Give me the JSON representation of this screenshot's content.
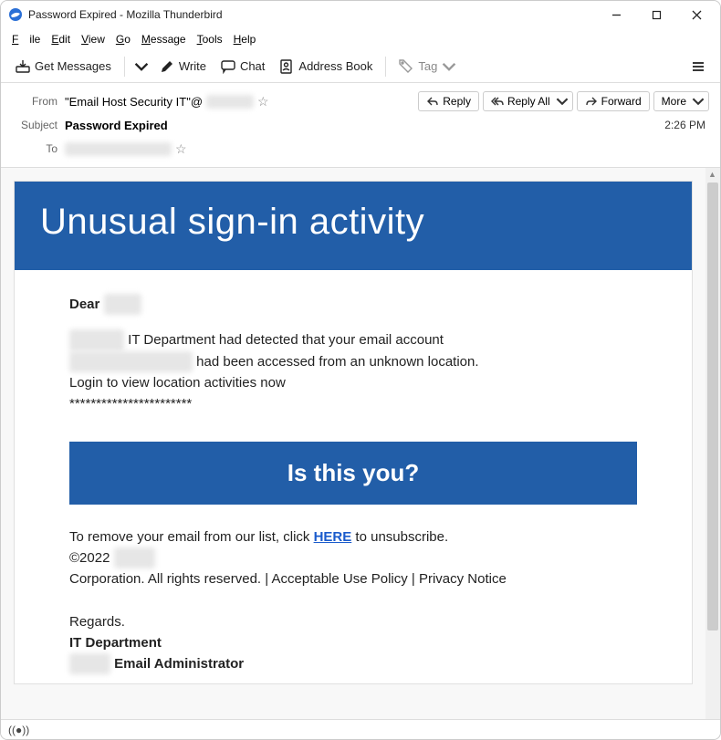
{
  "window_title": "Password Expired - Mozilla Thunderbird",
  "menu": {
    "file": "File",
    "edit": "Edit",
    "view": "View",
    "go": "Go",
    "message": "Message",
    "tools": "Tools",
    "help": "Help"
  },
  "toolbar": {
    "get_messages": "Get Messages",
    "write": "Write",
    "chat": "Chat",
    "address_book": "Address Book",
    "tag": "Tag"
  },
  "header": {
    "from_label": "From",
    "from_value": "\"Email Host Security IT\"@",
    "from_redacted": "xxxxxxxx",
    "subject_label": "Subject",
    "subject_value": "Password Expired",
    "to_label": "To",
    "to_redacted": "xxxxxxxxxxxxxxxxxx",
    "time": "2:26 PM"
  },
  "actions": {
    "reply": "Reply",
    "reply_all": "Reply All",
    "forward": "Forward",
    "more": "More"
  },
  "body": {
    "banner": "Unusual sign-in activity",
    "greet_prefix": "Dear ",
    "greet_redacted": "xxxxx",
    "para1_pre_redacted": "xxxxxxxx",
    "para1_rest": " IT Department had detected that your email account",
    "para2_redacted": "xxxxxxxxxxxxxxxxxx",
    "para2_rest": " had been accessed from an unknown location.",
    "para3": "Login to view location activities now",
    "stars": "***********************",
    "cta": "Is this you?",
    "unsub_pre": "To remove your email from our list, click  ",
    "unsub_link": "HERE",
    "unsub_post": " to unsubscribe.",
    "copy_pre": "©2022 ",
    "copy_redacted": "xxxxxx",
    "corp_line": "Corporation. All rights reserved. | Acceptable Use Policy | Privacy Notice",
    "regards": "Regards.",
    "dept": "IT Department",
    "admin_redacted": "xxxxxx",
    "admin_rest": " Email Administrator"
  }
}
